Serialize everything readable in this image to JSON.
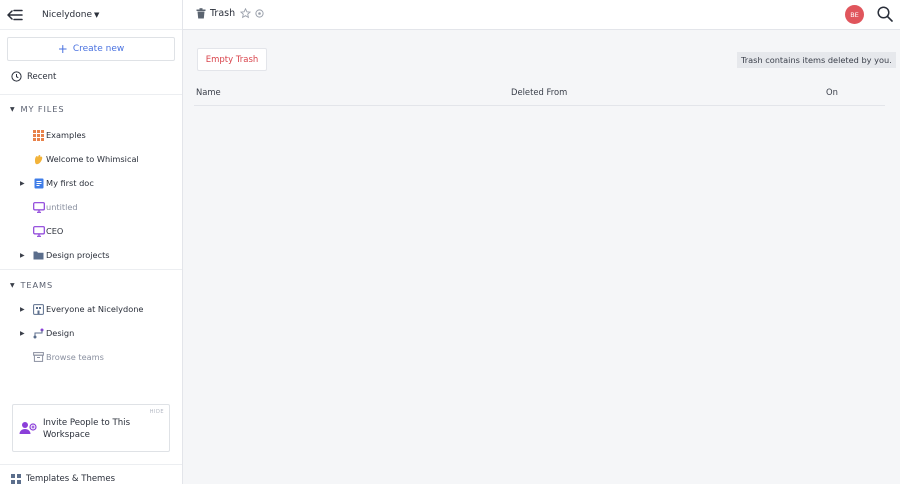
{
  "sidebar": {
    "workspace_name": "Nicelydone",
    "create_label": "Create new",
    "recent_label": "Recent",
    "my_files_heading": "MY FILES",
    "my_files": [
      {
        "label": "Examples",
        "icon": "grid-icon"
      },
      {
        "label": "Welcome to Whimsical",
        "icon": "wave-hand-icon"
      },
      {
        "label": "My first doc",
        "icon": "doc-icon"
      },
      {
        "label": "untitled",
        "icon": "board-icon"
      },
      {
        "label": "CEO",
        "icon": "board-icon"
      },
      {
        "label": "Design projects",
        "icon": "folder-icon"
      }
    ],
    "teams_heading": "TEAMS",
    "teams": [
      {
        "label": "Everyone at Nicelydone",
        "icon": "building-icon"
      },
      {
        "label": "Design",
        "icon": "flow-icon"
      },
      {
        "label": "Browse teams",
        "icon": "archive-icon"
      }
    ],
    "invite": {
      "hide_label": "HIDE",
      "text": "Invite People to This Workspace"
    },
    "templates_label": "Templates & Themes"
  },
  "header": {
    "title": "Trash",
    "avatar_initials": "BE"
  },
  "main": {
    "empty_trash_label": "Empty Trash",
    "info_text": "Trash contains items deleted by you.",
    "columns": [
      "Name",
      "Deleted From",
      "On"
    ]
  },
  "colors": {
    "accent": "#4a72e0",
    "danger": "#d9454d",
    "avatar": "#e0555c",
    "board_purple": "#8b3fd9"
  }
}
